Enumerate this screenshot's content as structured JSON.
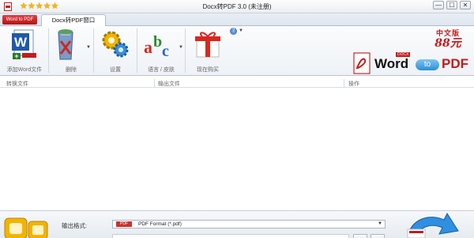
{
  "window": {
    "title": "Docx转PDF 3.0 (未注册)",
    "stars": "★★★★★",
    "buttons": [
      "—",
      "☐",
      "✕"
    ]
  },
  "menu_button": {
    "label": "Word to PDF"
  },
  "tabs": [
    {
      "label": "Docx转PDF窗口",
      "active": true
    }
  ],
  "ribbon": {
    "items": [
      {
        "label": "添加Word文件",
        "icon": "add-word-file-icon",
        "has_dropdown": false
      },
      {
        "label": "删除",
        "icon": "recycle-bin-icon",
        "has_dropdown": true
      },
      {
        "label": "设置",
        "icon": "gears-icon",
        "has_dropdown": false
      },
      {
        "label": "语言 / 皮肤",
        "icon": "abc-letters-icon",
        "has_dropdown": true
      },
      {
        "label": "现在购买",
        "icon": "gift-box-icon",
        "has_dropdown": false
      }
    ],
    "help_icon": "help-icon"
  },
  "logo": {
    "badge_line1": "中文版",
    "badge_line2": "88元",
    "word": "Word",
    "docx": "DOCX",
    "to": "to",
    "pdf": "PDF"
  },
  "table": {
    "columns": [
      "转换文件",
      "输出文件",
      "操作"
    ],
    "rows": []
  },
  "output": {
    "label": "输出格式:",
    "format_badge": "PDF",
    "format_value": "PDF Format (*.pdf)"
  },
  "colors": {
    "accent_red": "#c51a1a",
    "ribbon_bg": "#eef2f6",
    "border": "#b9c6d4"
  }
}
